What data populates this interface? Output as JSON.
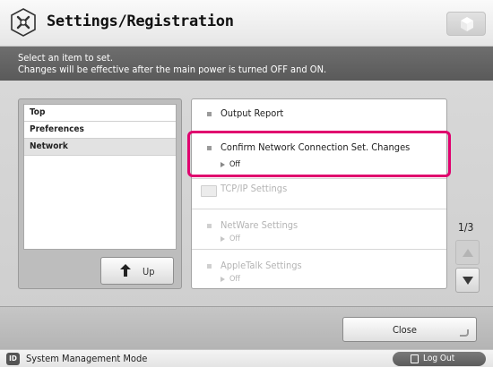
{
  "header": {
    "title": "Settings/Registration",
    "app_icon": "settings-registration-icon",
    "cube_icon": "cube-icon"
  },
  "instructions": {
    "line1": "Select an item to set.",
    "line2": "Changes will be effective after the main power is turned OFF and ON."
  },
  "tree": {
    "items": [
      {
        "label": "Top",
        "selected": false
      },
      {
        "label": "Preferences",
        "selected": false
      },
      {
        "label": "Network",
        "selected": true
      }
    ],
    "up_label": "Up"
  },
  "settings": {
    "items": [
      {
        "name": "Output Report",
        "value": "",
        "enabled": true,
        "type": "item"
      },
      {
        "name": "Confirm Network Connection Set. Changes",
        "value": "Off",
        "enabled": true,
        "type": "item",
        "highlighted": true
      },
      {
        "name": "TCP/IP Settings",
        "value": "",
        "enabled": false,
        "type": "folder"
      },
      {
        "name": "NetWare Settings",
        "value": "Off",
        "enabled": false,
        "type": "item"
      },
      {
        "name": "AppleTalk Settings",
        "value": "Off",
        "enabled": false,
        "type": "item"
      }
    ]
  },
  "pager": {
    "indicator": "1/3"
  },
  "footer": {
    "close_label": "Close"
  },
  "status": {
    "id_badge": "ID",
    "mode": "System Management Mode",
    "logout_label": "Log Out"
  },
  "colors": {
    "highlight": "#e0006e"
  }
}
